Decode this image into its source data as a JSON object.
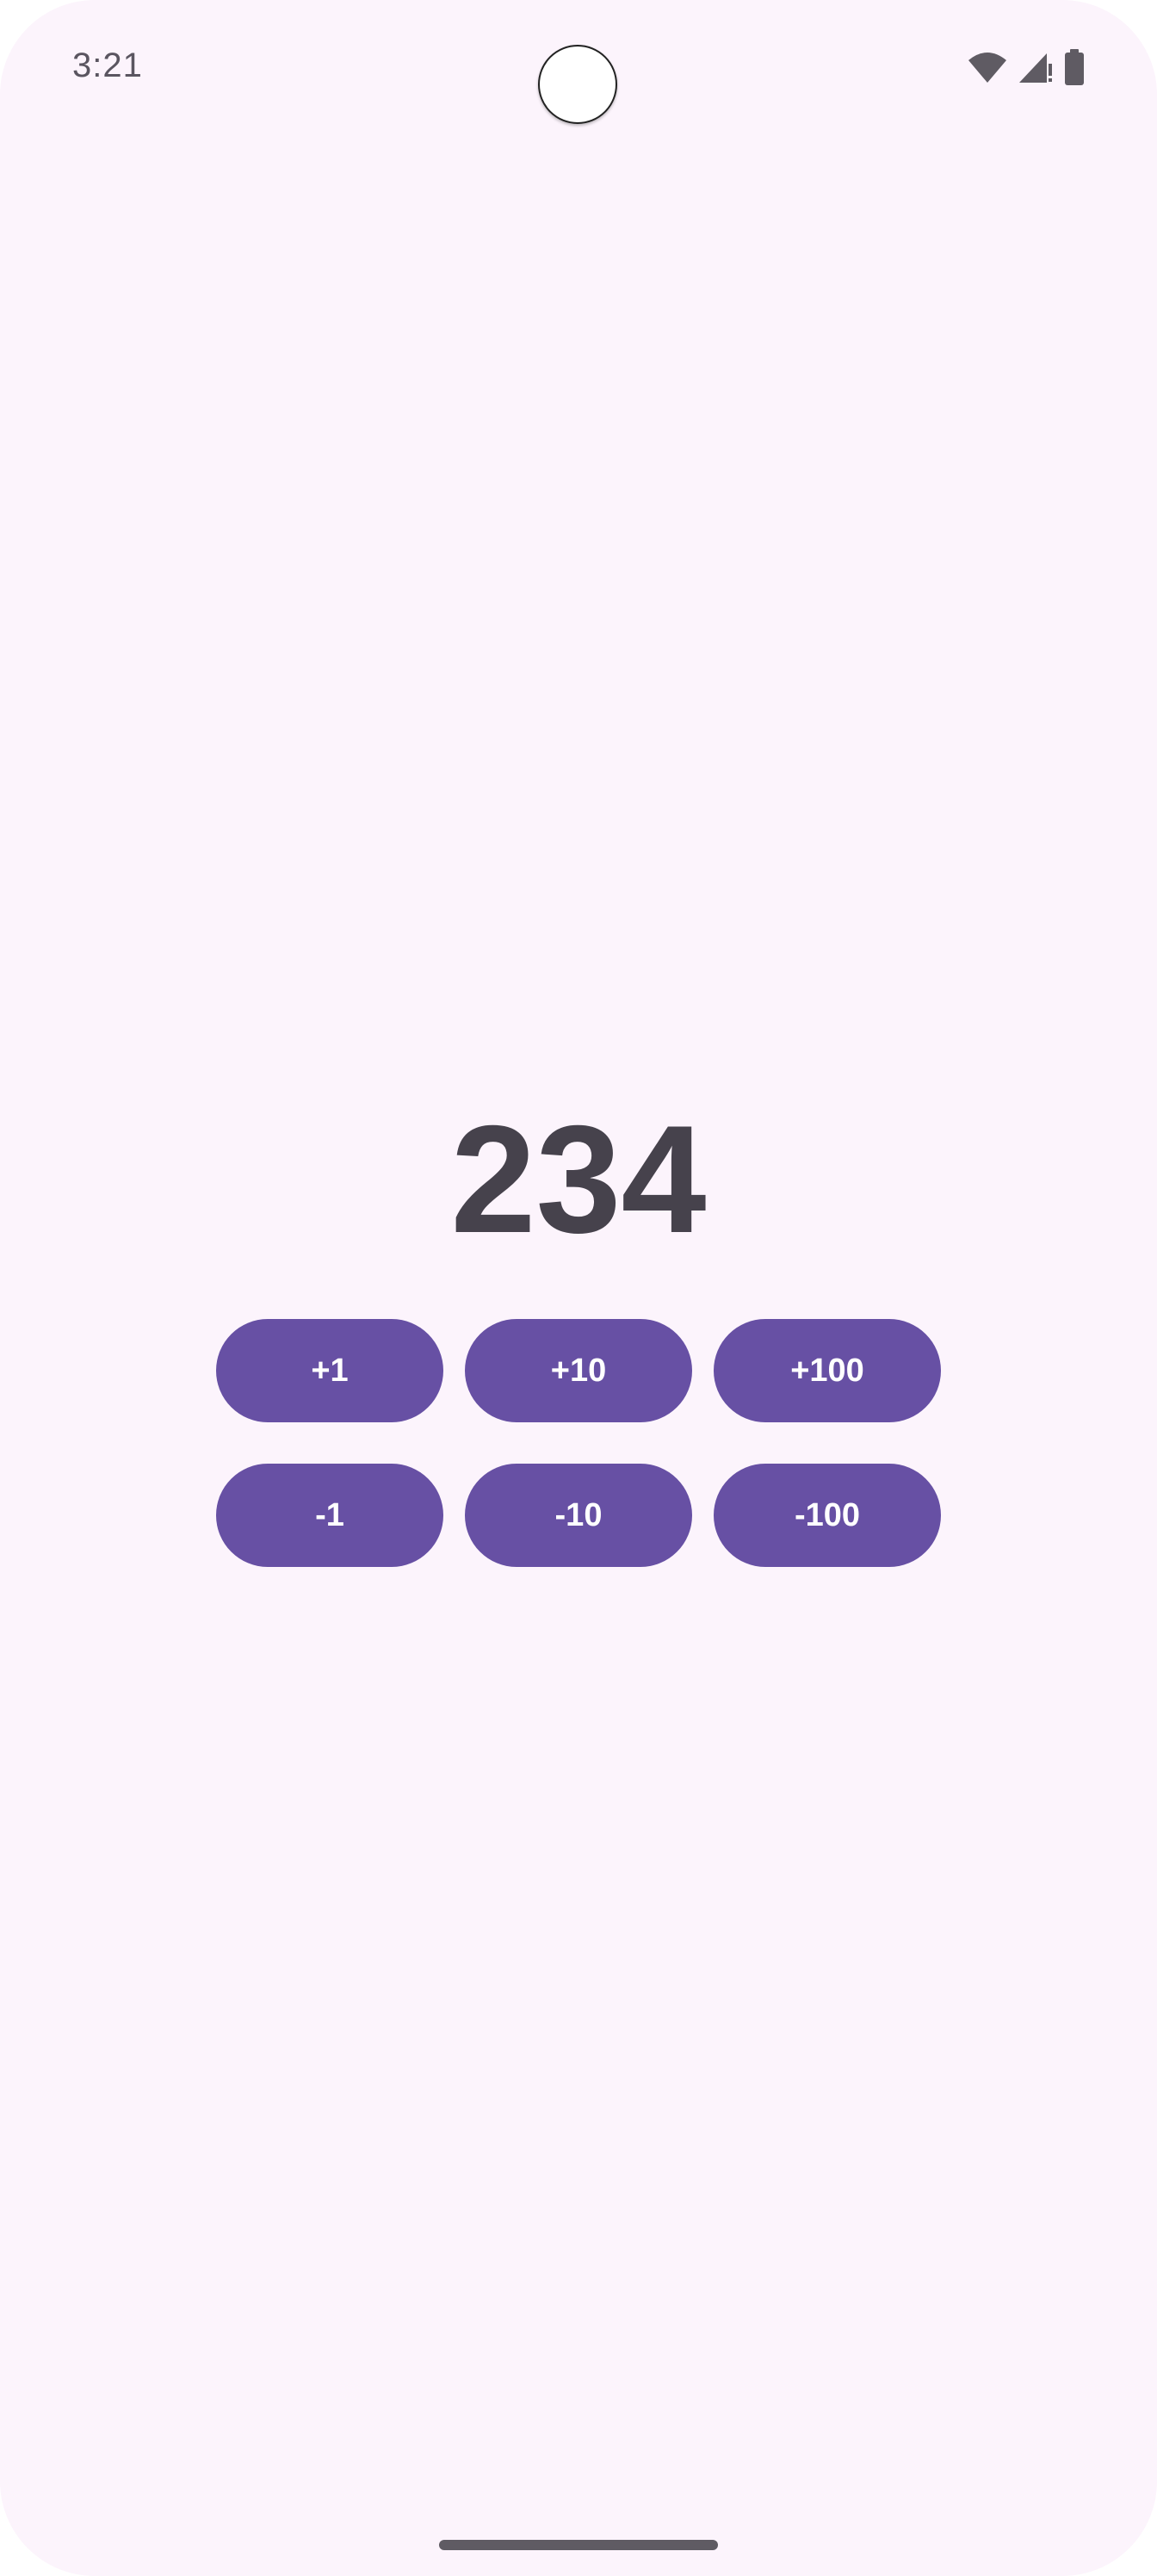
{
  "status_bar": {
    "time": "3:21",
    "icons": [
      "wifi-icon",
      "cellular-signal-alert-icon",
      "battery-icon"
    ]
  },
  "counter": {
    "value": "234"
  },
  "buttons": {
    "plus_1": "+1",
    "plus_10": "+10",
    "plus_100": "+100",
    "minus_1": "-1",
    "minus_10": "-10",
    "minus_100": "-100"
  },
  "colors": {
    "background": "#fcf4fc",
    "button": "#6750a4",
    "button_text": "#ffffff",
    "counter_text": "#46424c",
    "status_text": "#5a5560"
  }
}
